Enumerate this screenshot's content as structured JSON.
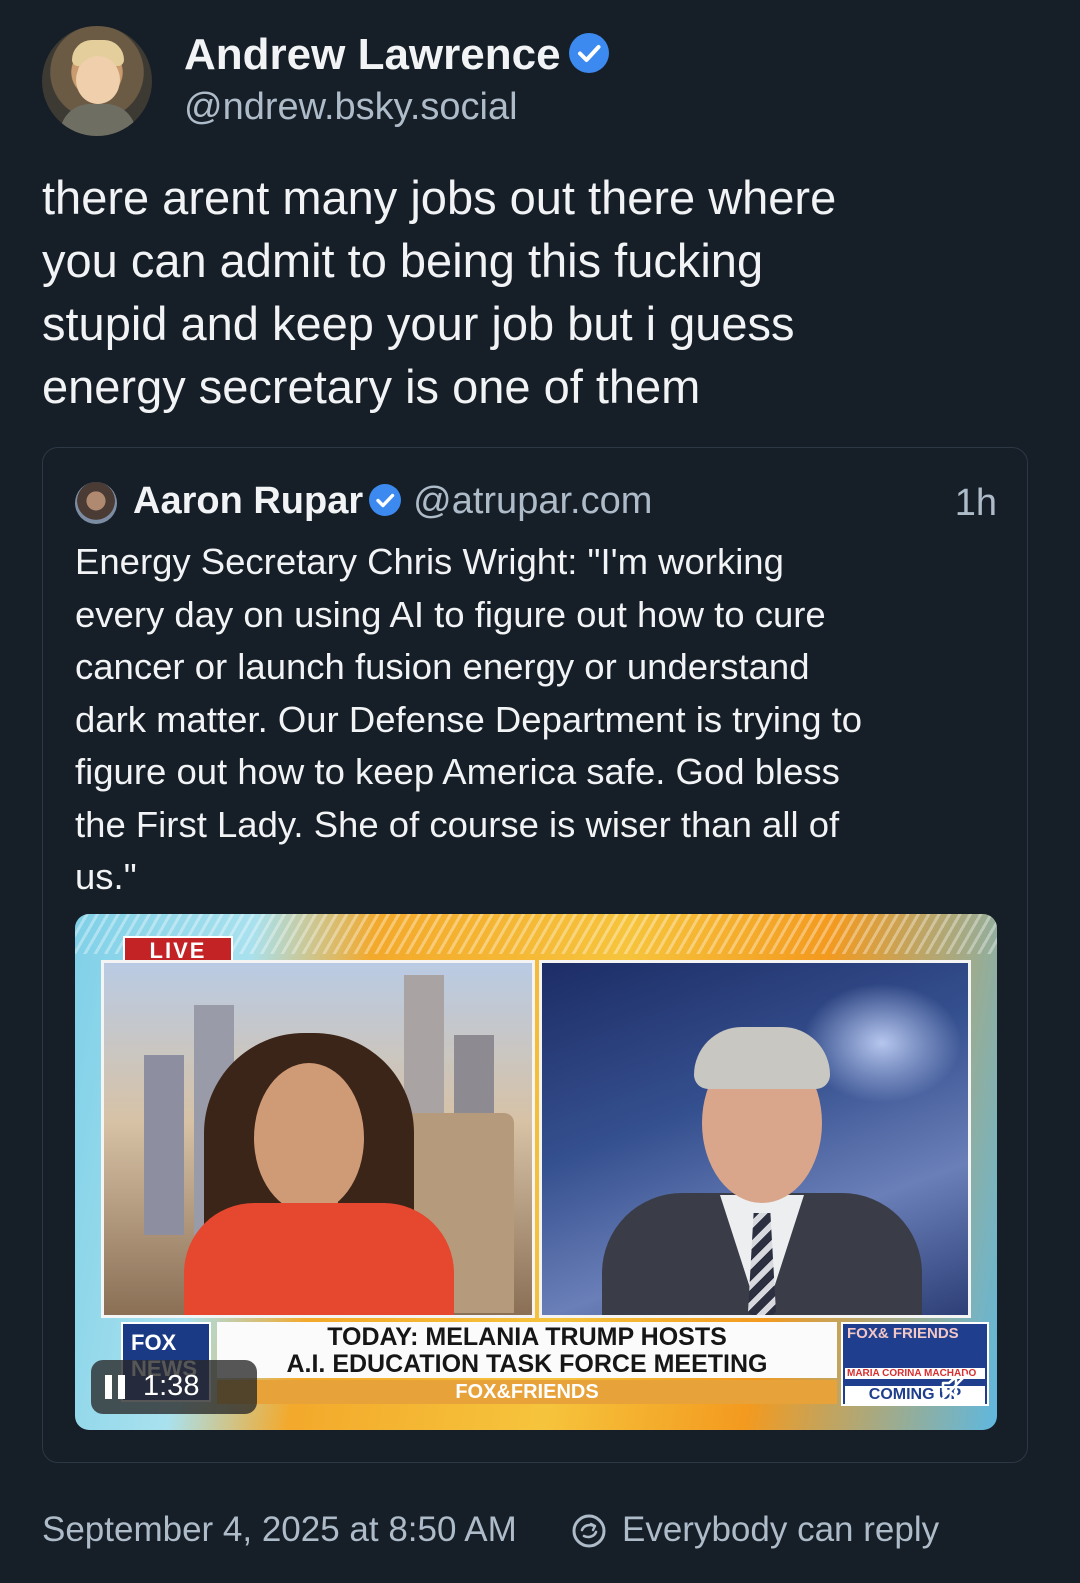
{
  "post": {
    "author_name": "Andrew Lawrence",
    "author_handle": "@ndrew.bsky.social",
    "text_lines": [
      "there arent many jobs out there where",
      "you can admit to being this fucking",
      "stupid and keep your job but i guess",
      "energy secretary is one of them"
    ]
  },
  "quote": {
    "author_name": "Aaron Rupar",
    "author_handle": "@atrupar.com",
    "time": "1h",
    "text_lines": [
      "Energy Secretary Chris Wright: \"I'm working",
      "every day on using AI to figure out how to cure",
      "cancer or launch fusion energy or understand",
      "dark matter. Our Defense Department is trying to",
      "figure out how to keep America safe. God bless",
      "the First Lady. She of course is wiser than all of",
      "us.\""
    ],
    "video": {
      "live_label": "LIVE",
      "network_logo": "FOX NEWS",
      "headline_line1": "TODAY: MELANIA TRUMP HOSTS",
      "headline_line2": "A.I. EDUCATION TASK FORCE MEETING",
      "show_name": "FOX&FRIENDS",
      "coming_brand": "FOX& FRIENDS",
      "coming_name": "MARIA CORINA MACHADO",
      "coming_label": "COMING UP",
      "duration": "1:38"
    }
  },
  "footer": {
    "timestamp": "September 4, 2025 at 8:50 AM",
    "reply_setting": "Everybody can reply"
  },
  "colors": {
    "background": "#161e27",
    "text": "#f1f3f5",
    "muted": "#aebbc9",
    "verified": "#3c8af0",
    "border": "#2c3845"
  },
  "icons": [
    "verified-badge-icon",
    "pause-icon",
    "mute-icon",
    "reply-settings-icon"
  ]
}
